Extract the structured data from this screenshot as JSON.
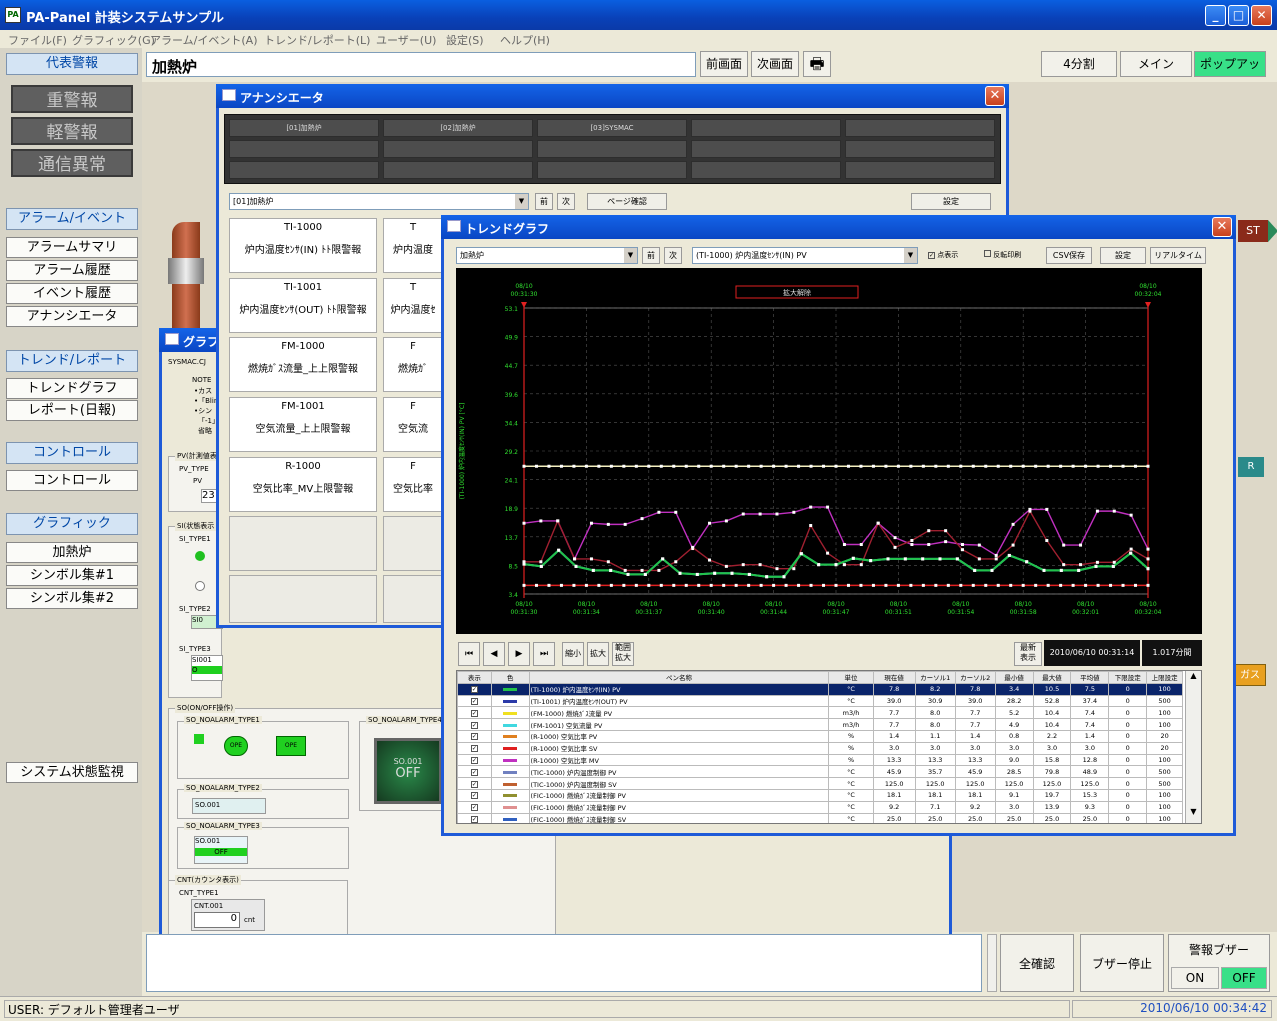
{
  "app": {
    "title": "PA-Panel 計装システムサンプル",
    "icon": "pa-panel-icon"
  },
  "menu": [
    "ファイル(F)",
    "グラフィック(G)",
    "アラーム/イベント(A)",
    "トレンド/レポート(L)",
    "ユーザー(U)",
    "設定(S)",
    "ヘルプ(H)"
  ],
  "left": {
    "alarm_header": "代表警報",
    "alarms": [
      "重警報",
      "軽警報",
      "通信異常"
    ],
    "sections": [
      {
        "title": "アラーム/イベント",
        "items": [
          "アラームサマリ",
          "アラーム履歴",
          "イベント履歴",
          "アナンシエータ"
        ]
      },
      {
        "title": "トレンド/レポート",
        "items": [
          "トレンドグラフ",
          "レポート(日報)"
        ]
      },
      {
        "title": "コントロール",
        "items": [
          "コントロール"
        ]
      },
      {
        "title": "グラフィック",
        "items": [
          "加熱炉",
          "シンボル集#1",
          "シンボル集#2"
        ]
      }
    ],
    "system_button": "システム状態監視"
  },
  "topbar": {
    "title": "加熱炉",
    "prev": "前画面",
    "next": "次画面",
    "split": "4分割",
    "main": "メイン",
    "popup": "ポップアップ"
  },
  "bg": {
    "rst": "ST",
    "r_label": "R",
    "gas": "ガス"
  },
  "annunciator": {
    "title": "アナンシエータ",
    "tabs": [
      "[01]加熱炉",
      "[02]加熱炉",
      "[03]SYSMAC",
      "",
      ""
    ],
    "combo": "[01]加熱炉",
    "prev": "前",
    "next": "次",
    "page_confirm": "ページ確認",
    "settings": "設定",
    "panes": [
      {
        "tag": "TI-1000",
        "text": "炉内温度ｾﾝｻ(IN) ﾄﾄ限警報"
      },
      {
        "tag": "TI-1001",
        "text": "炉内温度ｾﾝｻ(OUT) ﾄﾄ限警報"
      },
      {
        "tag": "FM-1000",
        "text": "燃焼ｶﾞｽ流量_上上限警報"
      },
      {
        "tag": "FM-1001",
        "text": "空気流量_上上限警報"
      },
      {
        "tag": "R-1000",
        "text": "空気比率_MV上限警報"
      }
    ],
    "panes2": [
      {
        "tag": "T",
        "text": "炉内温度"
      },
      {
        "tag": "T",
        "text": "炉内温度ｾ"
      },
      {
        "tag": "F",
        "text": "燃焼ｶﾞ"
      },
      {
        "tag": "F",
        "text": "空気流"
      },
      {
        "tag": "F",
        "text": "空気比率"
      }
    ]
  },
  "graphic": {
    "title": "グラフ",
    "header": "SYSMAC.CJ",
    "note": "NOTE",
    "note_lines": [
      "•カス",
      "•「Blin",
      "•シン",
      "「-1」",
      "省略"
    ],
    "pv_group": "PV(計測値表",
    "pv_type": "PV_TYPE",
    "pv_radio": "PV",
    "pv_value": "23",
    "si_group": "SI(状態表示",
    "si_type1": "SI_TYPE1",
    "si_type2": "SI_TYPE2",
    "si_type2_val": "SI0",
    "si_type3": "SI_TYPE3",
    "si_type3_tag": "SI001",
    "si_type3_val": "O",
    "so_group": "SO(ON/OFF操作)",
    "so_type1": "SO_NOALARM_TYPE1",
    "ope1": "OPE",
    "ope2": "OPE",
    "so_type4": "SO_NOALARM_TYPE4",
    "so_type4_tag": "SO.001",
    "so_type4_val": "OFF",
    "so_type2": "SO_NOALARM_TYPE2",
    "so_type2_val": "SO.001",
    "so_type3": "SO_NOALARM_TYPE3",
    "so_type3_tag": "SO.001",
    "so_type3_val": "OFF",
    "cnt_group": "CNT(カウンタ表示)",
    "cnt_type": "CNT_TYPE1",
    "cnt_tag": "CNT.001",
    "cnt_val": "0",
    "cnt_unit": "cnt"
  },
  "trend": {
    "title": "トレンドグラフ",
    "group_combo": "加熱炉",
    "prev": "前",
    "next": "次",
    "pen_combo": "(TI-1000) 炉内温度ｾﾝｻ(IN) PV",
    "opt_points": "点表示",
    "opt_invert": "反転印刷",
    "csv": "CSV保存",
    "settings": "設定",
    "realtime": "リアルタイム",
    "zoom_release": "拡大解除",
    "cursor_left": [
      "08/10",
      "00:31:30"
    ],
    "cursor_right": [
      "08/10",
      "00:32:04"
    ],
    "shrink": "縮小",
    "expand": "拡大",
    "range_zoom": "範囲\n拡大",
    "latest": "最新\n表示",
    "datetime": "2010/06/10 00:31:14",
    "span": "1.017分間",
    "nav": [
      "⏮",
      "◀",
      "▶",
      "⏭"
    ],
    "table_headers": [
      "表示",
      "色",
      "ペン名称",
      "単位",
      "現在値",
      "カーソル1",
      "カーソル2",
      "最小値",
      "最大値",
      "平均値",
      "下限設定",
      "上限設定"
    ],
    "rows": [
      {
        "color": "#22c24a",
        "name": "(TI-1000) 炉内温度ｾﾝｻ(IN) PV",
        "unit": "°C",
        "cur": "7.8",
        "c1": "8.2",
        "c2": "7.8",
        "min": "3.4",
        "max": "10.5",
        "avg": "7.5",
        "lo": "0",
        "hi": "100"
      },
      {
        "color": "#2b3aa8",
        "name": "(TI-1001) 炉内温度ｾﾝｻ(OUT) PV",
        "unit": "°C",
        "cur": "39.0",
        "c1": "30.9",
        "c2": "39.0",
        "min": "28.2",
        "max": "52.8",
        "avg": "37.4",
        "lo": "0",
        "hi": "500"
      },
      {
        "color": "#f0e020",
        "name": "(FM-1000) 燃焼ｶﾞｽ流量 PV",
        "unit": "m3/h",
        "cur": "7.7",
        "c1": "8.0",
        "c2": "7.7",
        "min": "5.2",
        "max": "10.4",
        "avg": "7.4",
        "lo": "0",
        "hi": "100"
      },
      {
        "color": "#40d8e0",
        "name": "(FM-1001) 空気流量 PV",
        "unit": "m3/h",
        "cur": "7.7",
        "c1": "8.0",
        "c2": "7.7",
        "min": "4.9",
        "max": "10.4",
        "avg": "7.4",
        "lo": "0",
        "hi": "100"
      },
      {
        "color": "#e08020",
        "name": "(R-1000) 空気比率 PV",
        "unit": "%",
        "cur": "1.4",
        "c1": "1.1",
        "c2": "1.4",
        "min": "0.8",
        "max": "2.2",
        "avg": "1.4",
        "lo": "0",
        "hi": "20"
      },
      {
        "color": "#e02020",
        "name": "(R-1000) 空気比率 SV",
        "unit": "%",
        "cur": "3.0",
        "c1": "3.0",
        "c2": "3.0",
        "min": "3.0",
        "max": "3.0",
        "avg": "3.0",
        "lo": "0",
        "hi": "20"
      },
      {
        "color": "#c030c0",
        "name": "(R-1000) 空気比率 MV",
        "unit": "%",
        "cur": "13.3",
        "c1": "13.3",
        "c2": "13.3",
        "min": "9.0",
        "max": "15.8",
        "avg": "12.8",
        "lo": "0",
        "hi": "100"
      },
      {
        "color": "#7080c0",
        "name": "(TIC-1000) 炉内温度制御 PV",
        "unit": "°C",
        "cur": "45.9",
        "c1": "35.7",
        "c2": "45.9",
        "min": "28.5",
        "max": "79.8",
        "avg": "48.9",
        "lo": "0",
        "hi": "500"
      },
      {
        "color": "#c06030",
        "name": "(TIC-1000) 炉内温度制御 SV",
        "unit": "°C",
        "cur": "125.0",
        "c1": "125.0",
        "c2": "125.0",
        "min": "125.0",
        "max": "125.0",
        "avg": "125.0",
        "lo": "0",
        "hi": "500"
      },
      {
        "color": "#909030",
        "name": "(FIC-1000) 燃焼ｶﾞｽ流量制御 PV",
        "unit": "°C",
        "cur": "18.1",
        "c1": "18.1",
        "c2": "18.1",
        "min": "9.1",
        "max": "19.7",
        "avg": "15.3",
        "lo": "0",
        "hi": "100"
      },
      {
        "color": "#e09090",
        "name": "(FIC-1000) 燃焼ｶﾞｽ流量制御 PV",
        "unit": "°C",
        "cur": "9.2",
        "c1": "7.1",
        "c2": "9.2",
        "min": "3.0",
        "max": "13.9",
        "avg": "9.3",
        "lo": "0",
        "hi": "100"
      },
      {
        "color": "#3060c0",
        "name": "(FIC-1000) 燃焼ｶﾞｽ流量制御 SV",
        "unit": "°C",
        "cur": "25.0",
        "c1": "25.0",
        "c2": "25.0",
        "min": "25.0",
        "max": "25.0",
        "avg": "25.0",
        "lo": "0",
        "hi": "100"
      }
    ]
  },
  "chart_data": {
    "type": "line",
    "ylabel": "(TI-1000) 炉内温度ｾﾝｻ(IN) PV [°C]",
    "ylim": [
      3.4,
      53.1
    ],
    "yticks": [
      "53.1",
      "49.9",
      "44.7",
      "39.6",
      "34.4",
      "29.2",
      "24.1",
      "18.9",
      "13.7",
      "8.5",
      "3.4"
    ],
    "xticks": [
      [
        "08/10",
        "00:31:30"
      ],
      [
        "08/10",
        "00:31:34"
      ],
      [
        "08/10",
        "00:31:37"
      ],
      [
        "08/10",
        "00:31:40"
      ],
      [
        "08/10",
        "00:31:44"
      ],
      [
        "08/10",
        "00:31:47"
      ],
      [
        "08/10",
        "00:31:51"
      ],
      [
        "08/10",
        "00:31:54"
      ],
      [
        "08/10",
        "00:31:58"
      ],
      [
        "08/10",
        "00:32:01"
      ],
      [
        "08/10",
        "00:32:04"
      ]
    ],
    "grid": true,
    "series": [
      {
        "color": "#f4f0c0",
        "values": [
          25.6,
          25.6,
          25.6,
          25.6,
          25.6,
          25.6,
          25.6,
          25.6,
          25.6,
          25.6,
          25.6,
          25.6,
          25.6,
          25.6,
          25.6,
          25.6,
          25.6,
          25.6,
          25.6,
          25.6,
          25.6,
          25.6,
          25.6,
          25.6,
          25.6,
          25.6,
          25.6,
          25.6,
          25.6,
          25.6,
          25.6,
          25.6,
          25.6,
          25.6,
          25.6,
          25.6,
          25.6,
          25.6,
          25.6,
          25.6,
          25.6,
          25.6,
          25.6,
          25.6,
          25.6,
          25.6,
          25.6,
          25.6,
          25.6,
          25.6,
          25.6
        ]
      },
      {
        "color": "#e02020",
        "values": [
          4.9,
          4.9,
          4.9,
          4.9,
          4.9,
          4.9,
          4.9,
          4.9,
          4.9,
          4.9,
          4.9,
          4.9,
          4.9,
          4.9,
          4.9,
          4.9,
          4.9,
          4.9,
          4.9,
          4.9,
          4.9,
          4.9,
          4.9,
          4.9,
          4.9,
          4.9,
          4.9,
          4.9,
          4.9,
          4.9,
          4.9,
          4.9,
          4.9,
          4.9,
          4.9,
          4.9,
          4.9,
          4.9,
          4.9,
          4.9,
          4.9,
          4.9,
          4.9,
          4.9,
          4.9,
          4.9,
          4.9,
          4.9,
          4.9,
          4.9,
          4.9
        ]
      },
      {
        "color": "#c030c0",
        "values": [
          15.7,
          16.1,
          16.1,
          9.5,
          15.7,
          15.5,
          15.5,
          16.5,
          17.6,
          17.6,
          11.3,
          15.7,
          16.1,
          17.3,
          17.3,
          17.3,
          17.6,
          18.5,
          18.5,
          12.0,
          12.0,
          15.7,
          13.2,
          12.0,
          12.0,
          12.5,
          12.0,
          11.9,
          10.1,
          15.5,
          18.1,
          18.1,
          11.9,
          11.9,
          17.8,
          17.8,
          17.1,
          11.2
        ]
      },
      {
        "color": "#a02030",
        "values": [
          9.0,
          9.0,
          16.1,
          9.5,
          9.5,
          9.0,
          7.5,
          7.5,
          7.5,
          9.0,
          11.5,
          9.3,
          8.2,
          8.5,
          8.5,
          7.8,
          7.8,
          15.3,
          10.5,
          8.5,
          8.5,
          15.7,
          11.5,
          12.7,
          14.4,
          14.4,
          11.1,
          9.5,
          9.5,
          11.9,
          17.8,
          12.7,
          8.5,
          8.5,
          8.9,
          8.9,
          11.2,
          9.5
        ]
      },
      {
        "color": "#40d8e0",
        "values": [
          8.6,
          8.2,
          11.0,
          8.2,
          7.5,
          7.5,
          6.8,
          6.8,
          9.5,
          7.0,
          6.8,
          7.0,
          7.0,
          6.8,
          6.4,
          6.4,
          10.4,
          8.5,
          8.5,
          9.6,
          9.2,
          9.5,
          9.5,
          9.5,
          9.5,
          9.5,
          7.5,
          7.5,
          10.1,
          9.0,
          7.5,
          7.5,
          7.5,
          8.2,
          8.2,
          10.5,
          7.8
        ]
      },
      {
        "color": "#22c24a",
        "values": [
          8.6,
          8.2,
          11.0,
          8.2,
          7.5,
          7.5,
          6.8,
          6.8,
          9.5,
          7.0,
          6.8,
          7.0,
          7.0,
          6.8,
          6.4,
          6.4,
          10.4,
          8.5,
          8.5,
          9.6,
          9.2,
          9.5,
          9.5,
          9.5,
          9.5,
          9.5,
          7.5,
          7.5,
          10.1,
          9.0,
          7.5,
          7.5,
          7.5,
          8.2,
          8.2,
          10.5,
          7.8
        ]
      }
    ]
  },
  "bottom": {
    "confirm_all": "全確認",
    "buzzer_stop": "ブザー停止",
    "alarm_buzzer": "警報ブザー",
    "on": "ON",
    "off": "OFF"
  },
  "status": {
    "user": "USER: デフォルト管理者ユーザ",
    "datetime": "2010/06/10 00:34:42"
  }
}
